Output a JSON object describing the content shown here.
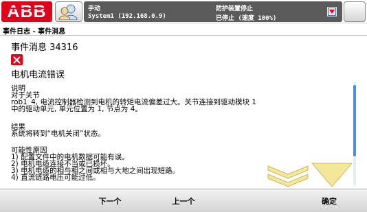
{
  "colors": {
    "abb_red": "#e2001a",
    "status_panel": "#5a5a5a",
    "scroll_thumb": "#4a90d9",
    "arrow_yellow": "#f5e79a"
  },
  "header": {
    "logo_text": "ABB",
    "mode": "手动",
    "system": "System1 (192.168.0.9)",
    "guard_status": "防护装置停止",
    "run_status": "已停止 (速度 100%)",
    "icons": {
      "user": "user-group-icon",
      "notice": "event-notice-icon",
      "close": "close-icon"
    }
  },
  "breadcrumb": "事件日志 - 事件消息",
  "event": {
    "title": "事件消息 34316",
    "icon": "error-icon",
    "name": "电机电流错误",
    "description_heading": "说明",
    "description_lines": [
      "对于关节",
      "rob1_4, 电流控制器检测到电机的转矩电流偏差过大。关节连接到驱动模块 1",
      "中的驱动单元, 单元位置为 1, 节点为 4。"
    ],
    "consequence_heading": "结果",
    "consequence_lines": [
      "系统将转到“电机关闭”状态。"
    ],
    "causes_heading": "可能性原因",
    "causes_lines": [
      "1) 配置文件中的电机数据可能有误。",
      "2) 电机电缆连接不当或已损坏。",
      "3) 电机电缆的相与相之间或相与大地之间出现短路。",
      "4) 直流链路电压可能过低。"
    ]
  },
  "scroll": {
    "position": 0.05,
    "visible_fraction": 0.7
  },
  "commands": {
    "next": "下一个",
    "previous": "上一个",
    "ok": "确定"
  }
}
